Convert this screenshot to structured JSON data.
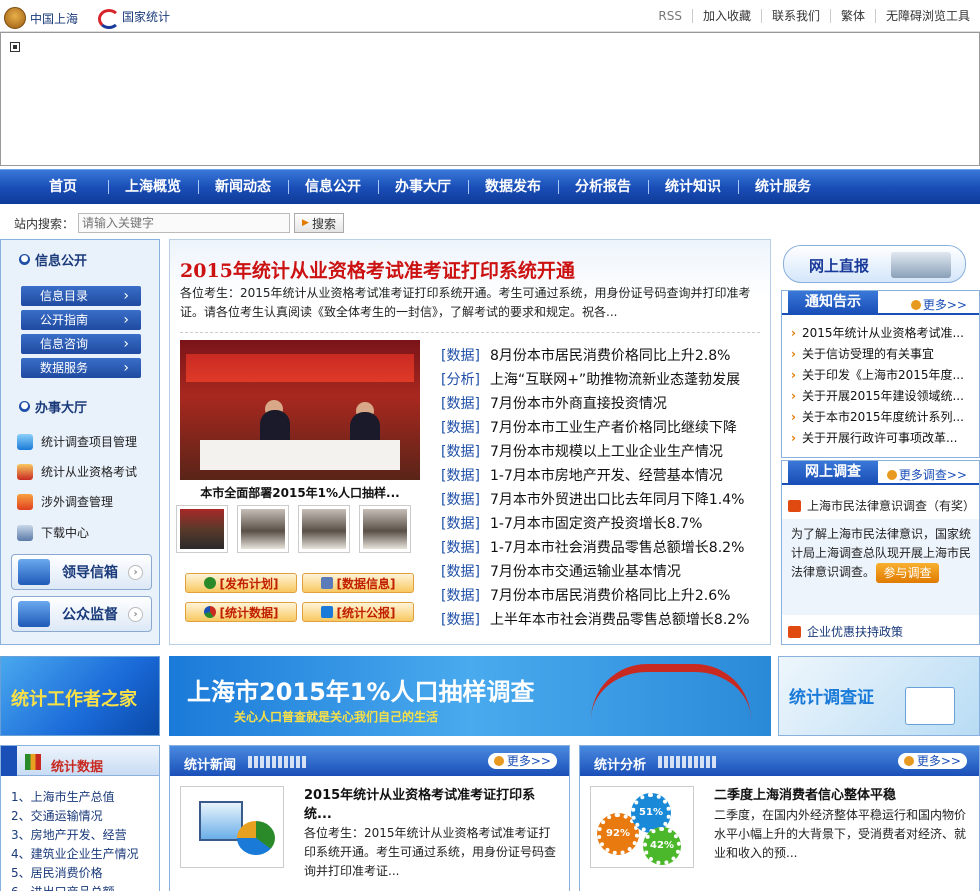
{
  "topbar": {
    "site1": "中国上海",
    "site2": "国家统计",
    "links": [
      "RSS",
      "加入收藏",
      "联系我们",
      "繁体",
      "无障碍浏览工具"
    ]
  },
  "nav": [
    "首页",
    "上海概览",
    "新闻动态",
    "信息公开",
    "办事大厅",
    "数据发布",
    "分析报告",
    "统计知识",
    "统计服务"
  ],
  "search": {
    "label": "站内搜索：",
    "placeholder": "请输入关键字",
    "button": "搜索"
  },
  "left": {
    "info_title": "信息公开",
    "info_items": [
      "信息目录",
      "公开指南",
      "信息咨询",
      "数据服务"
    ],
    "service_title": "办事大厅",
    "tools": [
      "统计调查项目管理",
      "统计从业资格考试",
      "涉外调查管理",
      "下载中心"
    ],
    "big_buttons": [
      "领导信箱",
      "公众监督"
    ]
  },
  "center": {
    "headline": "2015年统计从业资格考试准考证打印系统开通",
    "summary": "各位考生：2015年统计从业资格考试准考证打印系统开通。考生可通过系统，用身份证号码查询并打印准考证。请各位考生认真阅读《致全体考生的一封信》，了解考试的要求和规定。祝各...",
    "photo_caption": "本市全面部署2015年1%人口抽样...",
    "buttons": [
      "[发布计划]",
      "[数据信息]",
      "[统计数据]",
      "[统计公报]"
    ],
    "news": [
      {
        "tag": "[数据]",
        "text": "8月份本市居民消费价格同比上升2.8%"
      },
      {
        "tag": "[分析]",
        "text": "上海“互联网+”助推物流新业态蓬勃发展"
      },
      {
        "tag": "[数据]",
        "text": "7月份本市外商直接投资情况"
      },
      {
        "tag": "[数据]",
        "text": "7月份本市工业生产者价格同比继续下降"
      },
      {
        "tag": "[数据]",
        "text": "7月份本市规模以上工业企业生产情况"
      },
      {
        "tag": "[数据]",
        "text": "1-7月本市房地产开发、经营基本情况"
      },
      {
        "tag": "[数据]",
        "text": "7月本市外贸进出口比去年同月下降1.4%"
      },
      {
        "tag": "[数据]",
        "text": "1-7月本市固定资产投资增长8.7%"
      },
      {
        "tag": "[数据]",
        "text": "1-7月本市社会消费品零售总额增长8.2%"
      },
      {
        "tag": "[数据]",
        "text": "7月份本市交通运输业基本情况"
      },
      {
        "tag": "[数据]",
        "text": "7月份本市居民消费价格同比上升2.6%"
      },
      {
        "tag": "[数据]",
        "text": "上半年本市社会消费品零售总额增长8.2%"
      }
    ]
  },
  "right": {
    "live": "网上直报",
    "notice_title": "通知告示",
    "more": "更多>>",
    "notices": [
      "2015年统计从业资格考试准...",
      "关于信访受理的有关事宜",
      "关于印发《上海市2015年度...",
      "关于开展2015年建设领域统...",
      "关于本市2015年度统计系列...",
      "关于开展行政许可事项改革..."
    ],
    "survey_title": "网上调查",
    "survey_more": "更多调查>>",
    "survey_item": "上海市民法律意识调查（有奖）",
    "survey_desc": "为了解上海市民法律意识，国家统计局上海调查总队现开展上海市民法律意识调查。",
    "survey_btn": "参与调查",
    "policy": "企业优惠扶持政策"
  },
  "banners": {
    "b1": "统计工作者之家",
    "b2_title": "上海市2015年1%人口抽样调查",
    "b2_sub": "关心人口普查就是关心我们自己的生活",
    "b3": "统计调查证"
  },
  "bottom": {
    "stat_title": "统计数据",
    "stat_items": [
      "1、上海市生产总值",
      "2、交通运输情况",
      "3、房地产开发、经营",
      "4、建筑业企业生产情况",
      "5、居民消费价格",
      "6、进出口商品总额"
    ],
    "news_title": "统计新闻",
    "news_more": "更多>>",
    "news_headline": "2015年统计从业资格考试准考证打印系统...",
    "news_body": "各位考生：2015年统计从业资格考试准考证打印系统开通。考生可通过系统，用身份证号码查询并打印准考证...",
    "analysis_title": "统计分析",
    "analysis_more": "更多>>",
    "analysis_headline": "二季度上海消费者信心整体平稳",
    "analysis_body": "二季度，在国内外经济整体平稳运行和国内物价水平小幅上升的大背景下，受消费者对经济、就业和收入的预...",
    "gear_labels": [
      "92%",
      "51%",
      "42%"
    ]
  }
}
